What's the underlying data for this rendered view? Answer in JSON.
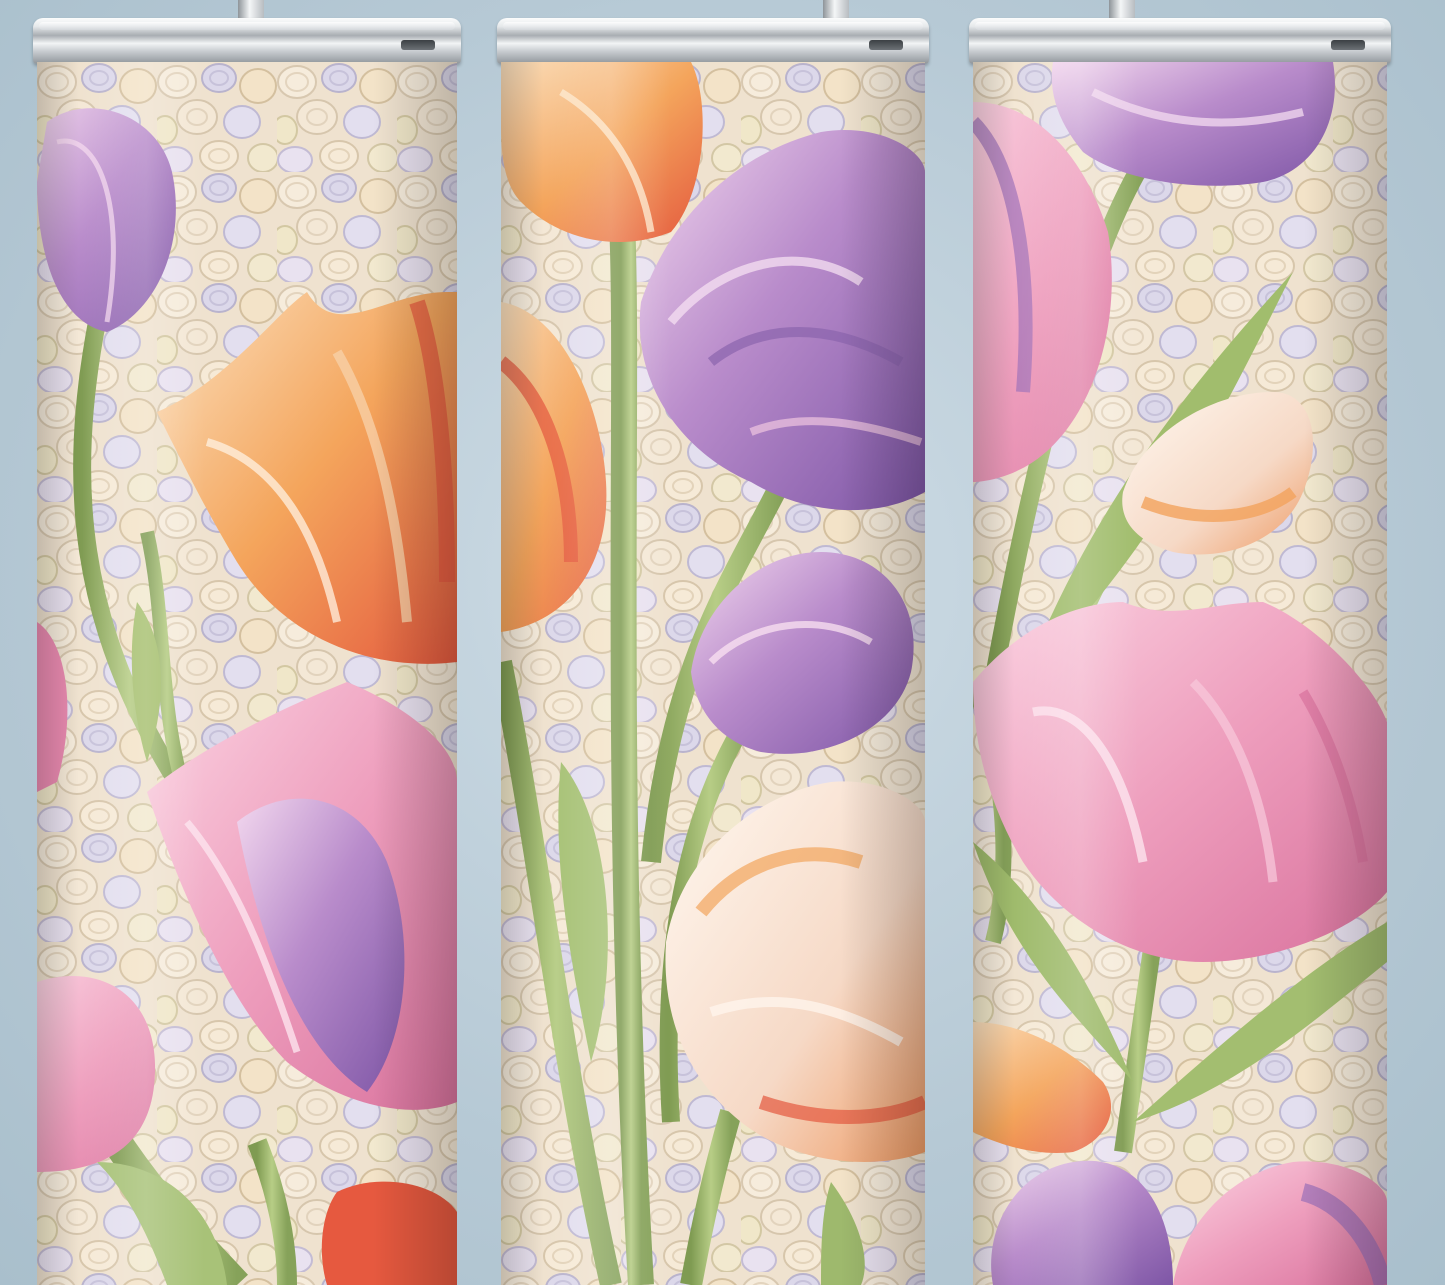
{
  "colors": {
    "background": "#b9cbd6",
    "petal_pink": "#f1a9c4",
    "petal_purple": "#9a6fb8",
    "petal_orange": "#f3a35c",
    "petal_red": "#e4573f",
    "petal_cream": "#f8eee0",
    "stem_green": "#9cb86a",
    "pebble_cream": "#f1e6d2",
    "pebble_lavender": "#d6d3e6"
  },
  "tumblers": [
    {
      "id": "left"
    },
    {
      "id": "center"
    },
    {
      "id": "right"
    }
  ]
}
